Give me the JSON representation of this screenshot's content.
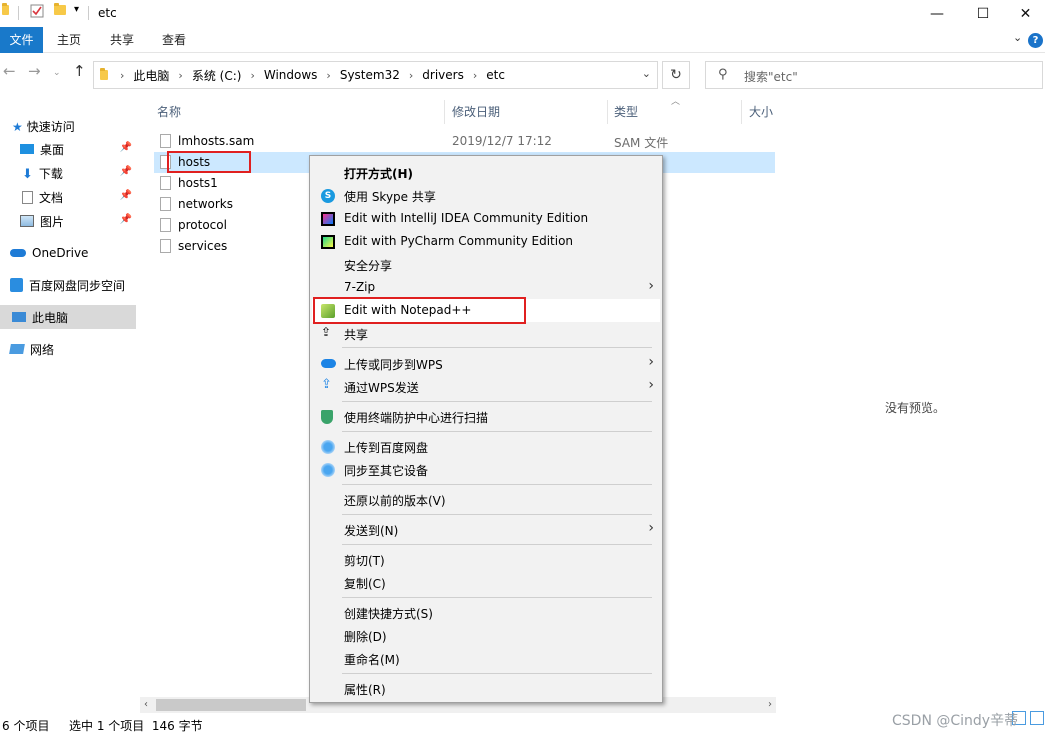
{
  "window": {
    "title": "etc",
    "controls": {
      "minimize": "—",
      "maximize": "☐",
      "close": "✕"
    }
  },
  "ribbon": {
    "tabs": [
      "文件",
      "主页",
      "共享",
      "查看"
    ],
    "help": "?"
  },
  "address": {
    "breadcrumbs": [
      "此电脑",
      "系统 (C:)",
      "Windows",
      "System32",
      "drivers",
      "etc"
    ],
    "search_placeholder": "搜索\"etc\""
  },
  "navigation": {
    "quick_access": "快速访问",
    "items": [
      {
        "label": "桌面",
        "icon": "desktop-icon",
        "pinned": true
      },
      {
        "label": "下载",
        "icon": "download-icon",
        "pinned": true
      },
      {
        "label": "文档",
        "icon": "document-icon",
        "pinned": true
      },
      {
        "label": "图片",
        "icon": "picture-icon",
        "pinned": true
      }
    ],
    "onedrive": "OneDrive",
    "baidu_sync": "百度网盘同步空间",
    "this_pc": "此电脑",
    "network": "网络"
  },
  "columns": {
    "name": "名称",
    "modified": "修改日期",
    "type": "类型",
    "size": "大小"
  },
  "files": [
    {
      "name": "lmhosts.sam",
      "modified": "2019/12/7 17:12",
      "type": "SAM 文件"
    },
    {
      "name": "hosts",
      "modified": "",
      "type": ""
    },
    {
      "name": "hosts1",
      "modified": "",
      "type": ""
    },
    {
      "name": "networks",
      "modified": "",
      "type": ""
    },
    {
      "name": "protocol",
      "modified": "",
      "type": ""
    },
    {
      "name": "services",
      "modified": "",
      "type": ""
    }
  ],
  "preview": {
    "empty_text": "没有预览。"
  },
  "status": {
    "item_count": "6 个项目",
    "selection": "选中 1 个项目  146 字节"
  },
  "watermark": "CSDN @Cindy辛蒂",
  "context_menu": {
    "open_with": "打开方式(H)",
    "skype": "使用 Skype 共享",
    "intellij": "Edit with IntelliJ IDEA Community Edition",
    "pycharm": "Edit with PyCharm Community Edition",
    "secure_share": "安全分享",
    "zip": "7-Zip",
    "notepadpp": "Edit with Notepad++",
    "share": "共享",
    "wps_upload": "上传或同步到WPS",
    "wps_send": "通过WPS发送",
    "scan": "使用终端防护中心进行扫描",
    "baidu_upload": "上传到百度网盘",
    "sync_devices": "同步至其它设备",
    "restore": "还原以前的版本(V)",
    "send_to": "发送到(N)",
    "cut": "剪切(T)",
    "copy": "复制(C)",
    "shortcut": "创建快捷方式(S)",
    "delete": "删除(D)",
    "rename": "重命名(M)",
    "properties": "属性(R)"
  }
}
